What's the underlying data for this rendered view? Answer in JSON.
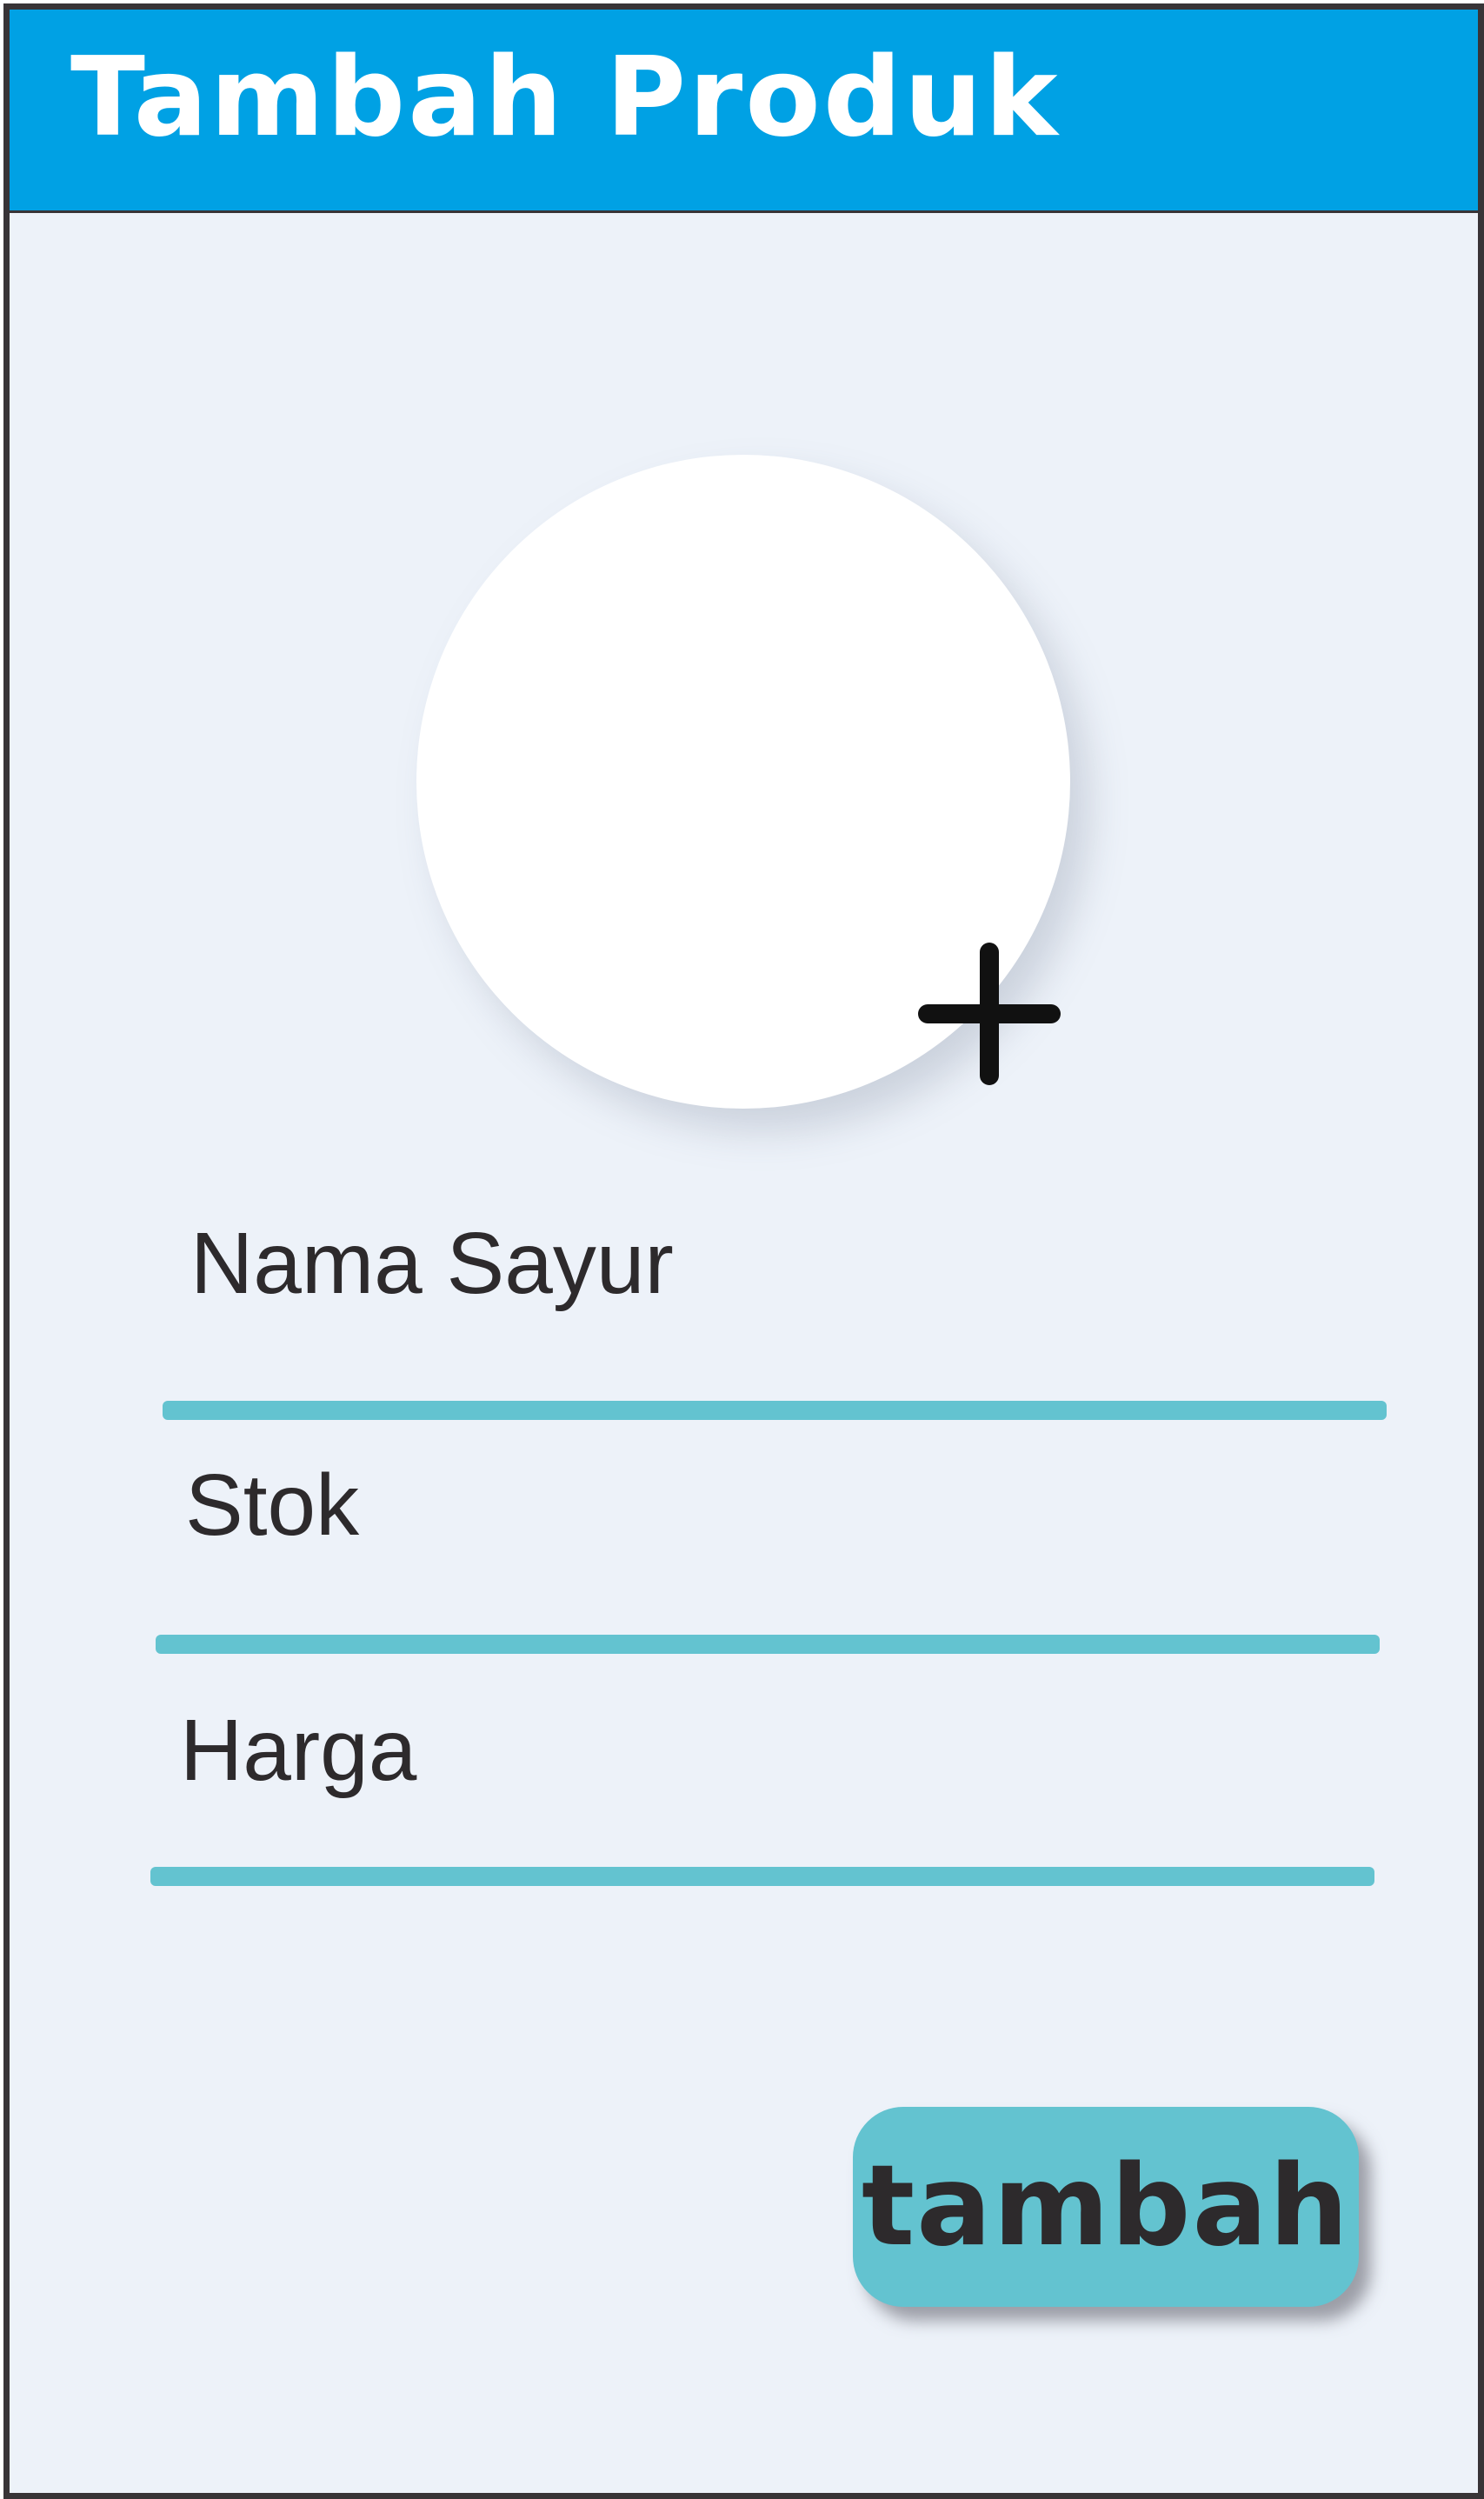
{
  "header": {
    "title": "Tambah Produk",
    "background": "#00a1e4",
    "title_color": "#ffffff"
  },
  "photo": {
    "add_icon": "plus-icon"
  },
  "form": {
    "fields": [
      {
        "label": "Nama Sayur"
      },
      {
        "label": "Stok"
      },
      {
        "label": "Harga"
      }
    ],
    "underline_color": "#63c3d0"
  },
  "submit": {
    "label": "tambah",
    "color": "#63c3d0"
  },
  "page": {
    "background": "#edf2f9",
    "border_color": "#383437"
  }
}
